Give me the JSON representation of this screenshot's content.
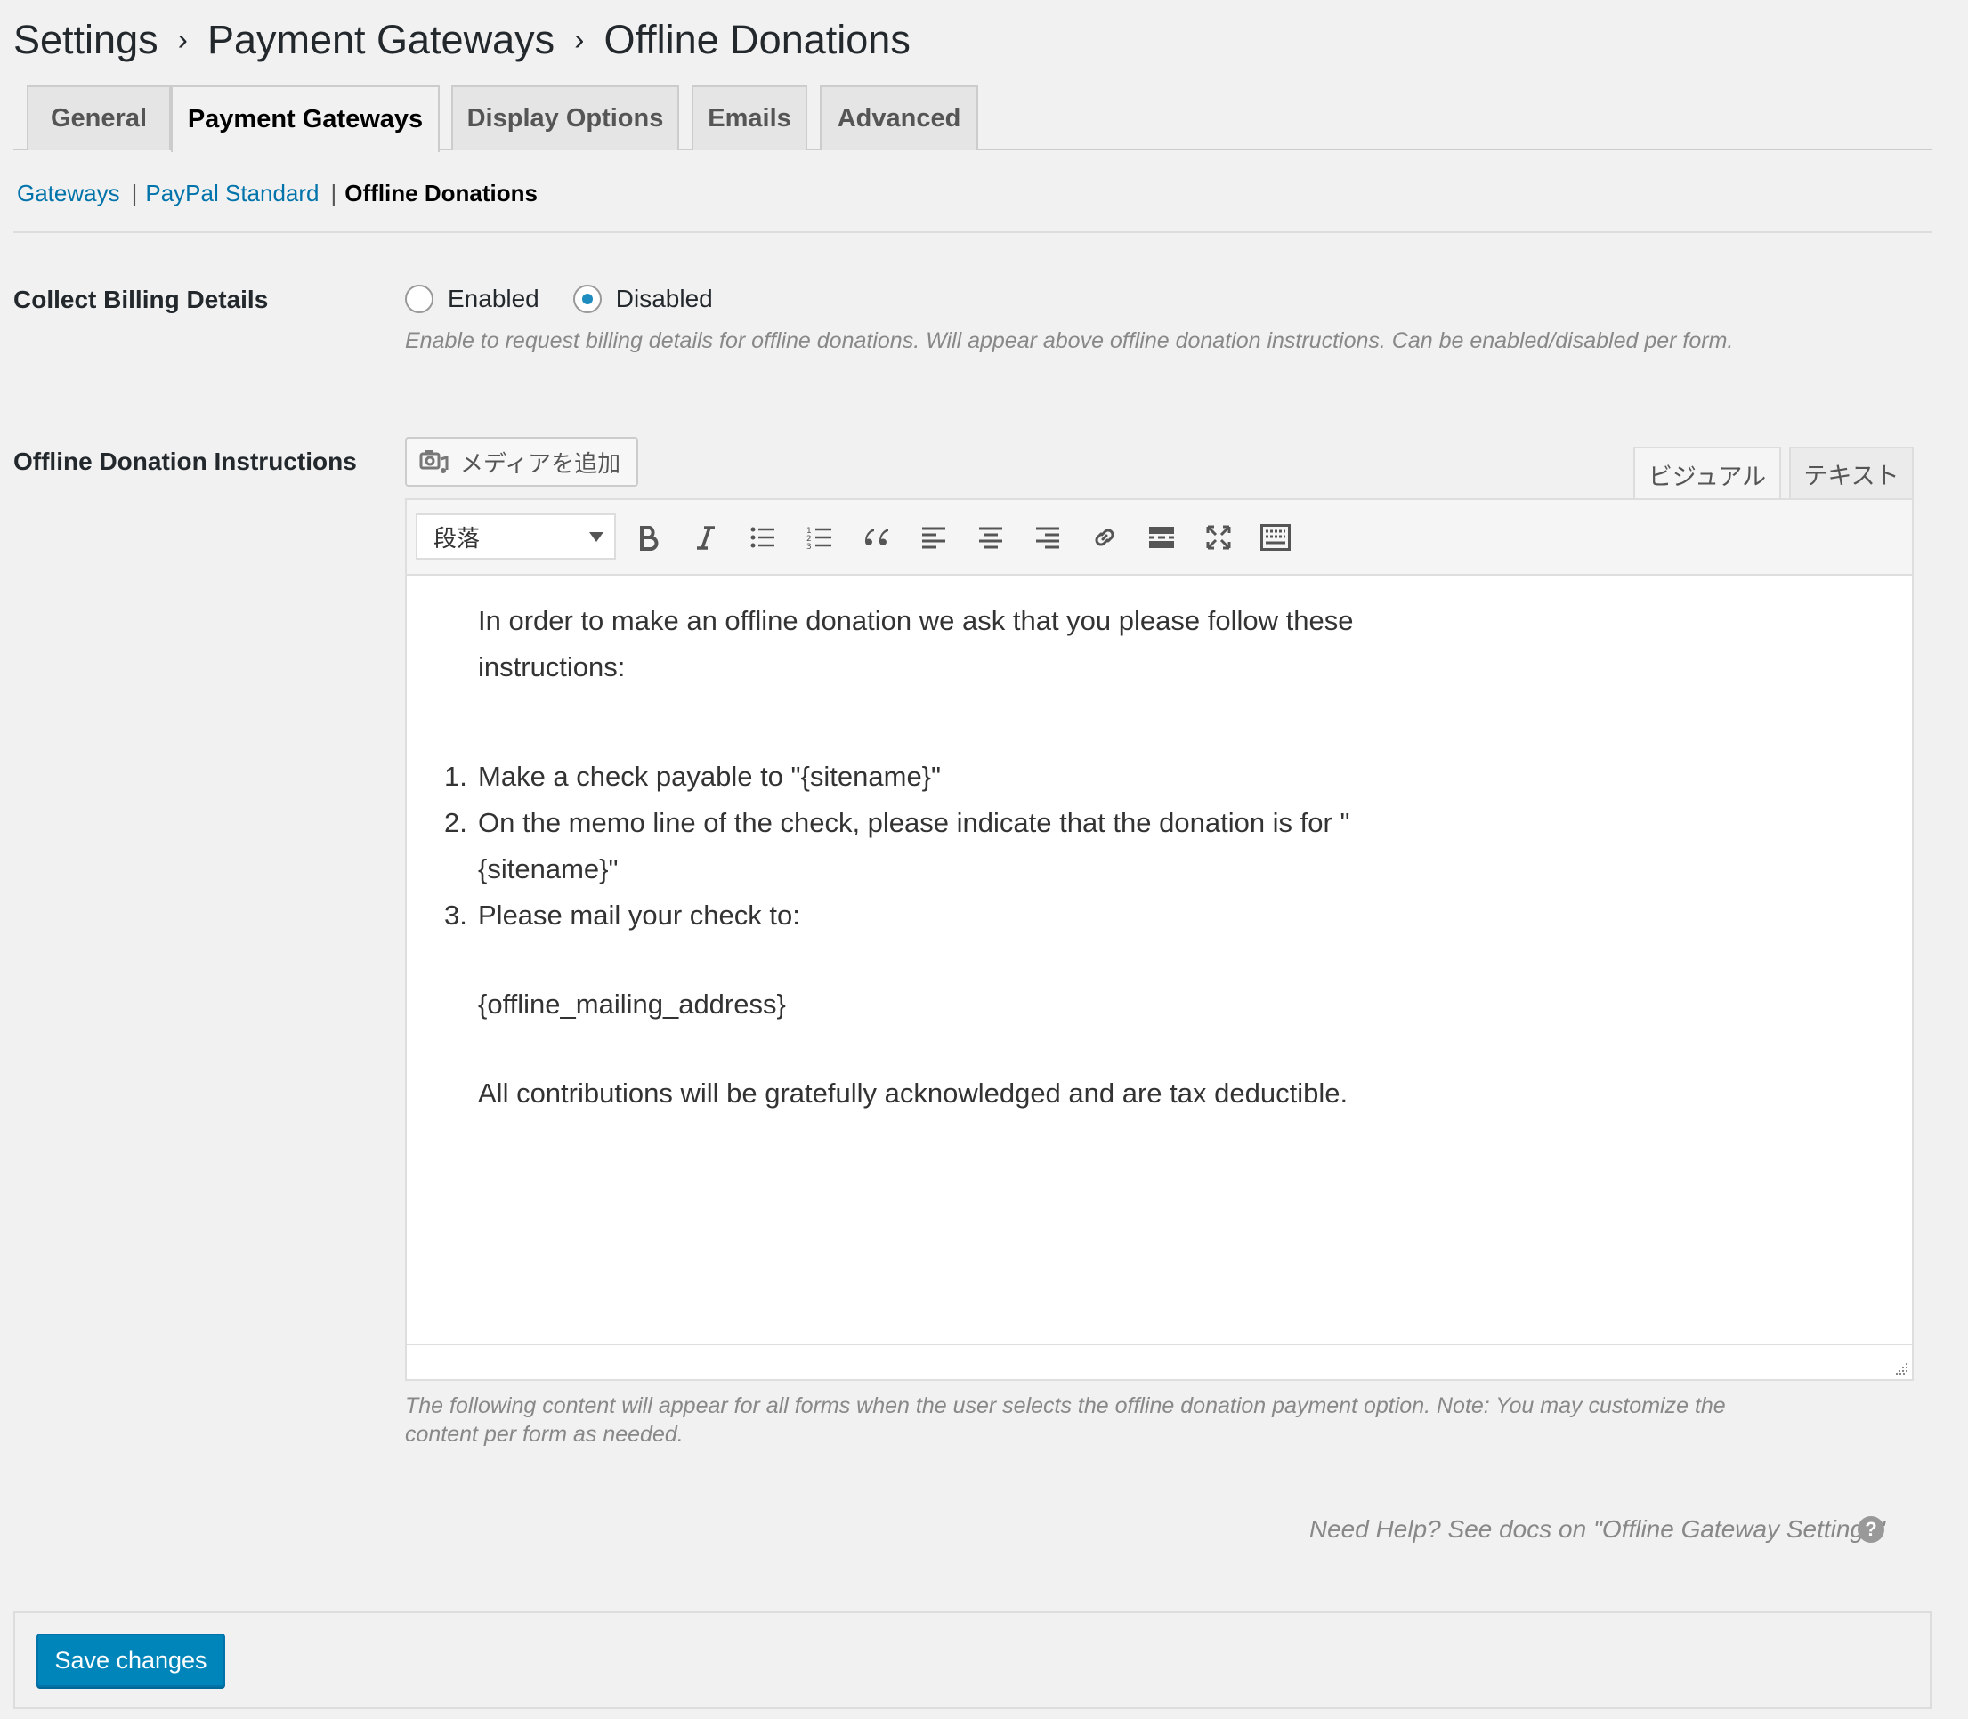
{
  "breadcrumb": {
    "items": [
      "Settings",
      "Payment Gateways",
      "Offline Donations"
    ],
    "separator": "›"
  },
  "tabs": [
    {
      "label": "General",
      "active": false
    },
    {
      "label": "Payment Gateways",
      "active": true
    },
    {
      "label": "Display Options",
      "active": false
    },
    {
      "label": "Emails",
      "active": false
    },
    {
      "label": "Advanced",
      "active": false
    }
  ],
  "sublinks": {
    "gateways": "Gateways",
    "paypal": "PayPal Standard",
    "current": "Offline Donations",
    "pipe": "|"
  },
  "billing": {
    "label": "Collect Billing Details",
    "options": [
      {
        "label": "Enabled",
        "checked": false
      },
      {
        "label": "Disabled",
        "checked": true
      }
    ],
    "description": "Enable to request billing details for offline donations. Will appear above offline donation instructions. Can be enabled/disabled per form."
  },
  "instructions": {
    "label": "Offline Donation Instructions",
    "add_media": "メディアを追加",
    "mode_visual": "ビジュアル",
    "mode_text": "テキスト",
    "format_select": "段落",
    "toolbar_icons": [
      "bold-icon",
      "italic-icon",
      "bullet-list-icon",
      "numbered-list-icon",
      "blockquote-icon",
      "align-left-icon",
      "align-center-icon",
      "align-right-icon",
      "link-icon",
      "read-more-icon",
      "fullscreen-icon",
      "toolbar-toggle-icon"
    ],
    "content": {
      "intro_line1": "In order to make an offline donation we ask that you please follow these",
      "intro_line2": "instructions:",
      "step1_num": "1.",
      "step1": "Make a check payable to \"{sitename}\"",
      "step2_num": "2.",
      "step2_line1": "On the memo line of the check, please indicate that the donation is for \"",
      "step2_line2": "{sitename}\"",
      "step3_num": "3.",
      "step3": "Please mail your check to:",
      "address": "{offline_mailing_address}",
      "closing": "All contributions will be gratefully acknowledged and are tax deductible."
    },
    "description_line1": "The following content will appear for all forms when the user selects the offline donation payment option. Note: You may customize the",
    "description_line2": "content per form as needed."
  },
  "help": {
    "text": "Need Help? See docs on \"Offline Gateway Settings\"",
    "icon": "?"
  },
  "footer": {
    "save_label": "Save changes"
  },
  "colors": {
    "link": "#0073aa",
    "primary_button": "#0085ba",
    "radio_checked": "#1e8cbe",
    "background": "#f1f1f1"
  }
}
